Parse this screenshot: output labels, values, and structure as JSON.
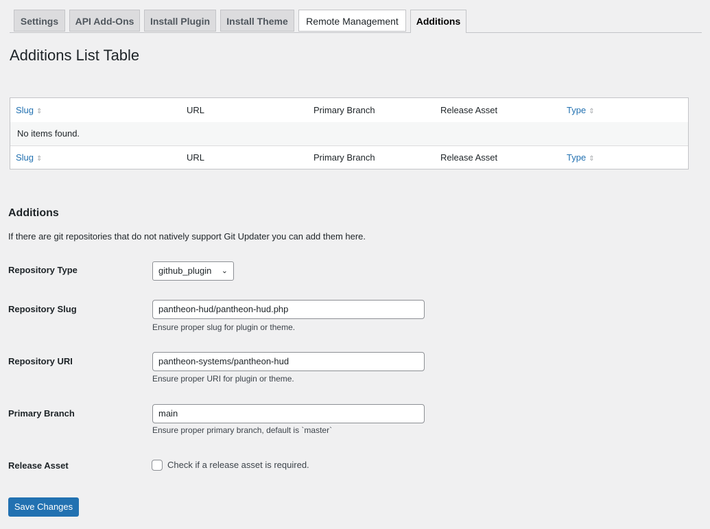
{
  "tabs": [
    {
      "label": "Settings"
    },
    {
      "label": "API Add-Ons"
    },
    {
      "label": "Install Plugin"
    },
    {
      "label": "Install Theme"
    },
    {
      "label": "Remote Management"
    },
    {
      "label": "Additions"
    }
  ],
  "page_title": "Additions List Table",
  "table": {
    "columns": [
      "Slug",
      "URL",
      "Primary Branch",
      "Release Asset",
      "Type"
    ],
    "empty_message": "No items found."
  },
  "section": {
    "title": "Additions",
    "description": "If there are git repositories that do not natively support Git Updater you can add them here."
  },
  "form": {
    "repo_type": {
      "label": "Repository Type",
      "value": "github_plugin"
    },
    "repo_slug": {
      "label": "Repository Slug",
      "value": "pantheon-hud/pantheon-hud.php",
      "help": "Ensure proper slug for plugin or theme."
    },
    "repo_uri": {
      "label": "Repository URI",
      "value": "pantheon-systems/pantheon-hud",
      "help": "Ensure proper URI for plugin or theme."
    },
    "primary_branch": {
      "label": "Primary Branch",
      "value": "main",
      "help": "Ensure proper primary branch, default is `master`"
    },
    "release_asset": {
      "label": "Release Asset",
      "checkbox_label": "Check if a release asset is required.",
      "checked": false
    }
  },
  "save_label": "Save Changes",
  "colors": {
    "accent": "#2271b1"
  }
}
